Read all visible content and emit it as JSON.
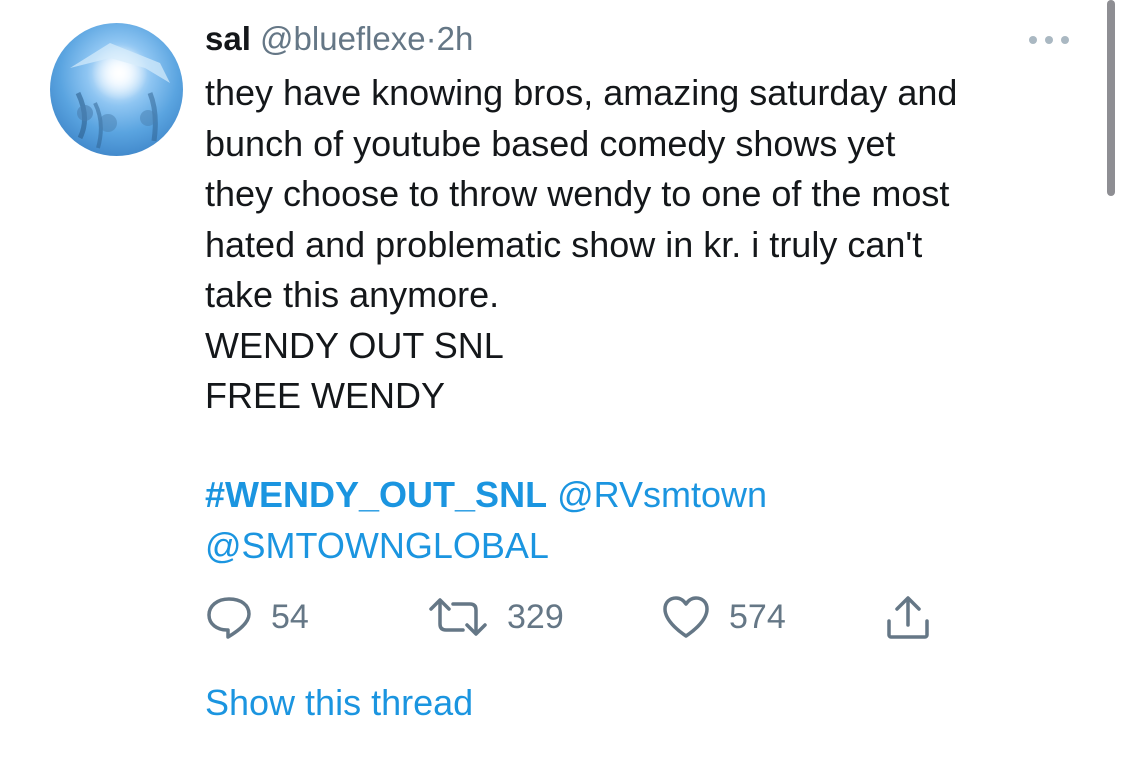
{
  "tweet": {
    "author": {
      "name": "sal",
      "handle": "@blueflexe",
      "separator": "·",
      "time": "2h",
      "avatar_icon": "avatar-image"
    },
    "more_icon": "ellipsis-icon",
    "lines": [
      "they have knowing bros, amazing saturday and",
      "bunch of youtube based comedy shows yet",
      "they choose to throw wendy to one of the most",
      "hated and problematic show in kr. i truly can't",
      "take this anymore.",
      "WENDY OUT SNL",
      "FREE WENDY"
    ],
    "hashtag": "#WENDY_OUT_SNL",
    "mention_1": "@RVsmtown",
    "mention_2": "@SMTOWNGLOBAL",
    "actions": {
      "reply": {
        "icon": "reply-icon",
        "count": "54"
      },
      "retweet": {
        "icon": "retweet-icon",
        "count": "329"
      },
      "like": {
        "icon": "heart-icon",
        "count": "574"
      },
      "share": {
        "icon": "share-icon"
      }
    },
    "show_thread": "Show this thread"
  },
  "colors": {
    "link": "#1b95e0",
    "secondary": "#657786",
    "text": "#14171a",
    "icon": "#657786"
  }
}
